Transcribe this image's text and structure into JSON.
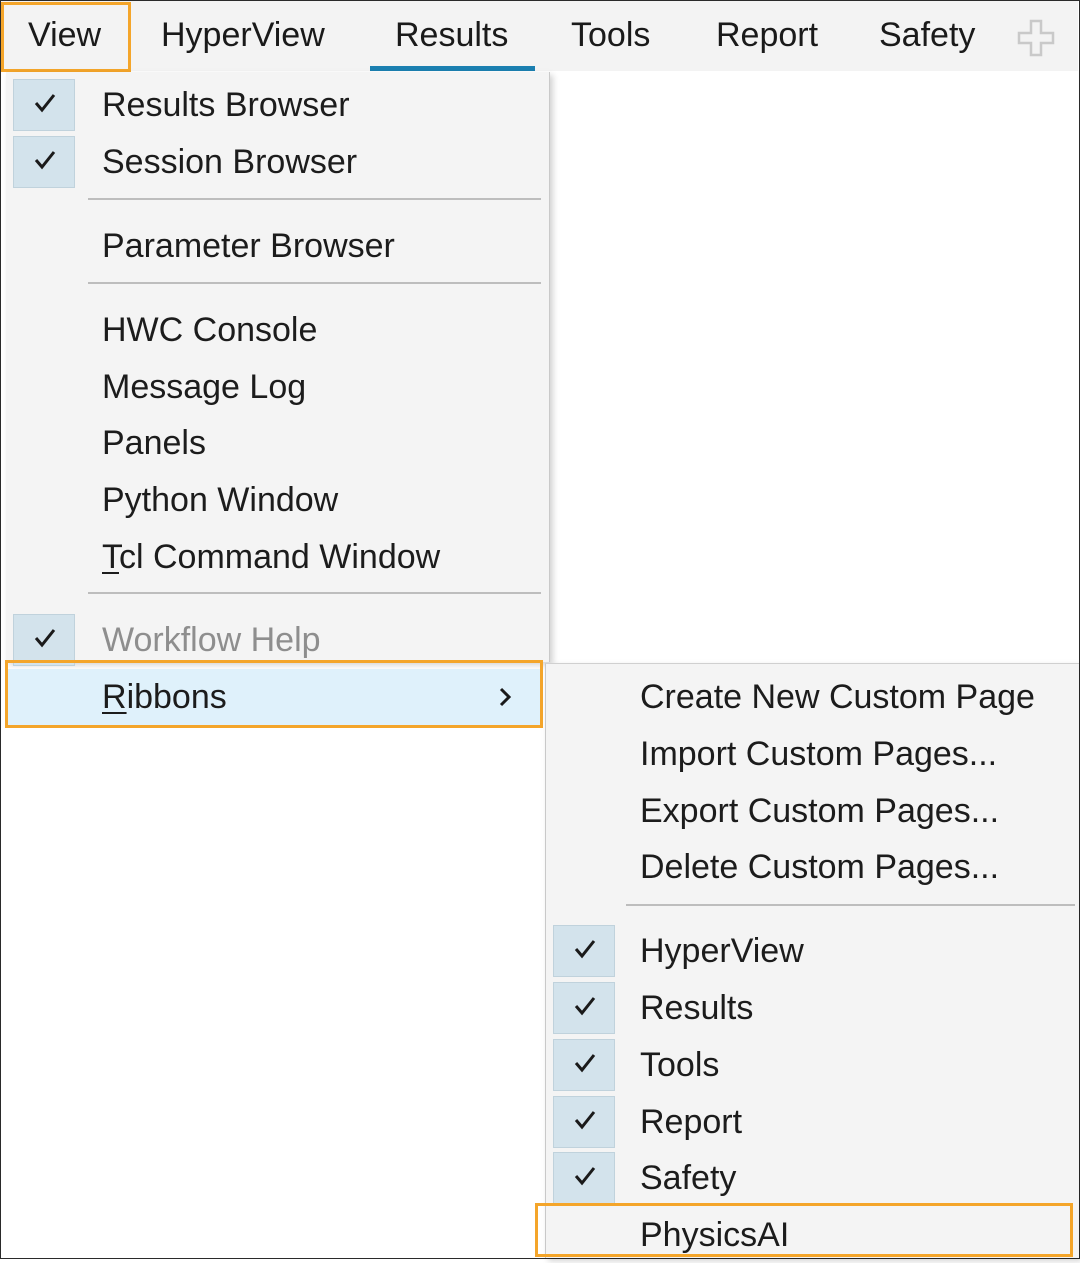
{
  "menubar": {
    "tabs": [
      {
        "label": "View"
      },
      {
        "label": "HyperView"
      },
      {
        "label": "Results"
      },
      {
        "label": "Tools"
      },
      {
        "label": "Report"
      },
      {
        "label": "Safety"
      }
    ],
    "add_icon": "plus-icon"
  },
  "view_menu": {
    "items": [
      {
        "label": "Results Browser",
        "checked": true
      },
      {
        "label": "Session Browser",
        "checked": true
      },
      {
        "label": "Parameter Browser",
        "checked": false
      },
      {
        "label": "HWC Console",
        "checked": false
      },
      {
        "label": "Message Log",
        "checked": false
      },
      {
        "label": "Panels",
        "checked": false
      },
      {
        "label": "Python Window",
        "checked": false
      },
      {
        "label_mnemonic": "T",
        "label_rest": "cl Command Window",
        "checked": false
      },
      {
        "label": "Workflow Help",
        "checked": true,
        "disabled": true
      },
      {
        "label_mnemonic": "R",
        "label_rest": "ibbons",
        "submenu": true
      }
    ]
  },
  "ribbons_menu": {
    "items": [
      {
        "label": "Create New Custom Page"
      },
      {
        "label": "Import Custom Pages..."
      },
      {
        "label": "Export Custom Pages..."
      },
      {
        "label": "Delete Custom Pages..."
      },
      {
        "label": "HyperView",
        "checked": true
      },
      {
        "label": "Results",
        "checked": true
      },
      {
        "label": "Tools",
        "checked": true
      },
      {
        "label": "Report",
        "checked": true
      },
      {
        "label": "Safety",
        "checked": true
      },
      {
        "label": "PhysicsAI",
        "checked": false
      }
    ]
  },
  "colors": {
    "highlight_box": "#f4a52a",
    "active_tab_underline": "#1b7fb0",
    "hover_row": "#dff1fb",
    "check_bg": "#d3e3ec"
  }
}
